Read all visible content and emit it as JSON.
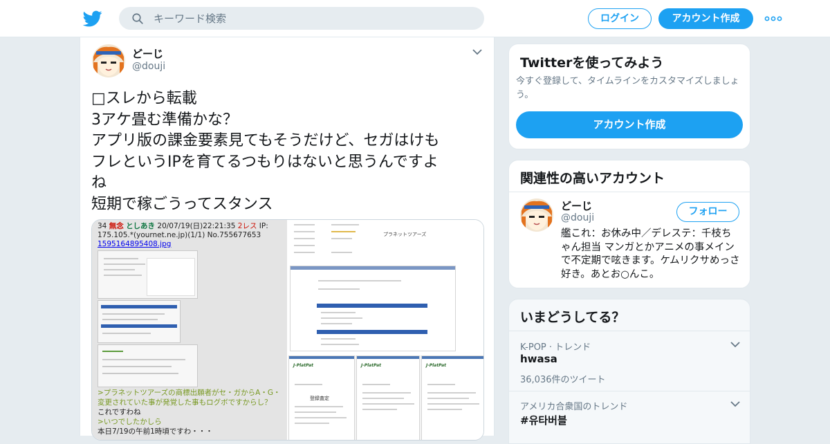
{
  "header": {
    "logo_icon": "twitter-bird-icon",
    "search_placeholder": "キーワード検索",
    "login_label": "ログイン",
    "signup_label": "アカウント作成",
    "more_icon": "more-dots-icon",
    "brand_color": "#1da1f2"
  },
  "tweet": {
    "author_name": "どーじ",
    "author_handle": "@douji",
    "text_lines": [
      "□スレから転載",
      "3アケ畳む準備かな？",
      "アプリ版の課金要素見てもそうだけど、セガはけも",
      "フレというIPを育てるつもりはないと思うんですよ",
      "ね",
      "短期で稼ごうってスタンス"
    ],
    "media": {
      "post_header_prefix": "34",
      "post_header_mumei": "無念",
      "post_header_name": "としあき",
      "post_header_date": "20/07/19(日)22:21:35",
      "post_header_res": "2レス",
      "post_header_ip": "IP:",
      "post_ip_line": "175.105.*(yournet.ne.jp)(1/1) No.755677653",
      "post_file": "1595164895408.jpg",
      "quote_1": ">プラネットツアーズの商標出願者がセ・ガからA・G・",
      "quote_2": "変更されていた事が発覚した事もログボですからし？",
      "reply_1": "これですわね",
      "quote_3": ">いつでしたかしら",
      "reply_2": "本日7/19の午前1時頃ですわ・・・",
      "doc_title": "プラネットツアーズ",
      "doc_label": "登録査定"
    }
  },
  "sidebar": {
    "signup_card": {
      "title": "Twitterを使ってみよう",
      "description": "今すぐ登録して、タイムラインをカスタマイズしましょう。",
      "button_label": "アカウント作成"
    },
    "related_card": {
      "title": "関連性の高いアカウント",
      "account_name": "どーじ",
      "account_handle": "@douji",
      "follow_label": "フォロー",
      "bio": "艦これ：お休み中／デレステ：千枝ちゃん担当 マンガとかアニメの事メインで不定期で呟きます。ケムリクサめっさ好き。あとお○んこ。"
    },
    "trends_card": {
      "title": "いまどうしてる？",
      "trends": [
        {
          "context": "K-POP · トレンド",
          "name": "hwasa",
          "count": "36,036件のツイート"
        },
        {
          "context": "アメリカ合衆国のトレンド",
          "name": "#유타버블",
          "count": ""
        }
      ]
    }
  }
}
